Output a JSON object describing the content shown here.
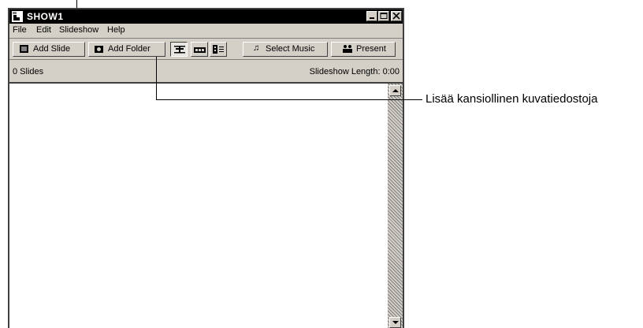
{
  "window": {
    "title": "SHOW1",
    "controls": [
      "minimize",
      "maximize",
      "close"
    ]
  },
  "menubar": {
    "items": [
      "File",
      "Edit",
      "Slideshow",
      "Help"
    ]
  },
  "toolbar": {
    "add_slide_label": "Add Slide",
    "add_folder_label": "Add Folder",
    "view_modes": [
      "timeline-view-icon",
      "filmstrip-view-icon",
      "list-view-icon"
    ],
    "select_music_label": "Select Music",
    "present_label": "Present"
  },
  "status": {
    "slide_count": "0 Slides",
    "length": "Slideshow Length: 0:00"
  },
  "annotation": {
    "callout_text": "Lisää kansiollinen kuvatiedostoja"
  }
}
